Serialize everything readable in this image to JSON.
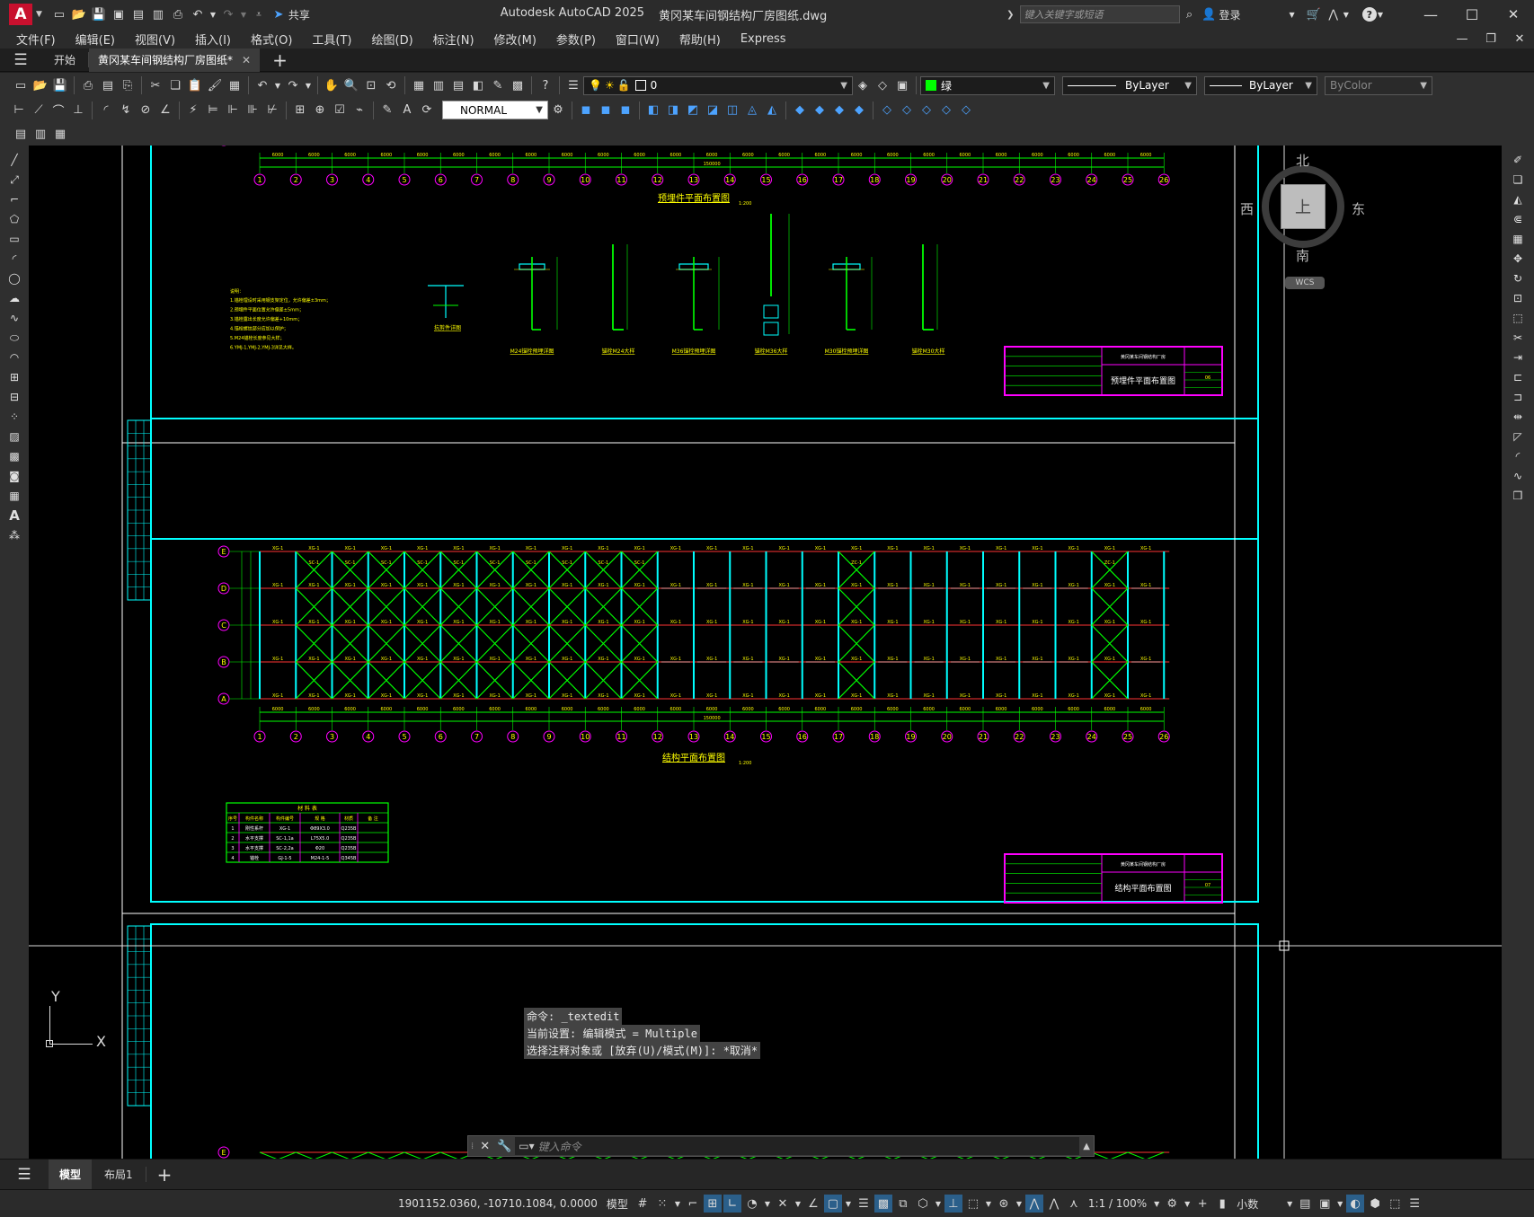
{
  "title_bar": {
    "app_letter": "A",
    "share_label": "共享",
    "window_title": "Autodesk AutoCAD 2025",
    "file_name": "黄冈某车间钢结构厂房图纸.dwg",
    "search_placeholder": "键入关键字或短语",
    "login_label": "登录"
  },
  "menu": [
    "文件(F)",
    "编辑(E)",
    "视图(V)",
    "插入(I)",
    "格式(O)",
    "工具(T)",
    "绘图(D)",
    "标注(N)",
    "修改(M)",
    "参数(P)",
    "窗口(W)",
    "帮助(H)",
    "Express"
  ],
  "doc_tabs": {
    "start": "开始",
    "active": "黄冈某车间钢结构厂房图纸*"
  },
  "toolbar": {
    "layer_value": "0",
    "color_value": "绿",
    "linetype_value": "ByLayer",
    "lineweight_value": "ByLayer",
    "plotstyle_value": "ByColor",
    "dimstyle_value": "NORMAL",
    "accent_green": "#00ff00"
  },
  "viewcube": {
    "north": "北",
    "south": "南",
    "east": "东",
    "west": "西",
    "face": "上",
    "wcs": "WCS"
  },
  "ucs": {
    "y": "Y",
    "x": "X"
  },
  "drawing": {
    "sheet1_title": "预埋件平面布置图",
    "sheet2_title": "结构平面布置图",
    "scale": "1:200",
    "overall_dim": "150000",
    "bay_dim": "6000",
    "axis_numbers": [
      "1",
      "2",
      "3",
      "4",
      "5",
      "6",
      "7",
      "8",
      "9",
      "10",
      "11",
      "12",
      "13",
      "14",
      "15",
      "16",
      "17",
      "18",
      "19",
      "20",
      "21",
      "22",
      "23",
      "24",
      "25",
      "26"
    ],
    "axis_letters": [
      "E",
      "D",
      "C",
      "B",
      "A"
    ],
    "notes_heading": "说明：",
    "notes": [
      "1.锚栓埋设时采用钢支架定位，允许偏差±3mm；",
      "2.预埋件平面位置允许偏差±5mm；",
      "3.锚栓露出长度允许偏差+10mm；",
      "4.锚栓螺纹部分应加以保护；",
      "5.M24锚栓长度参见大样；",
      "6.YMJ-1,YMJ-2,YMJ-3详见大样。"
    ],
    "detail_labels": [
      "抗剪件详图",
      "M24锚栓预埋详图",
      "锚栓M24大样",
      "M36锚栓预埋详图",
      "锚栓M36大样",
      "M30锚栓预埋详图",
      "锚栓M30大样"
    ],
    "title_block": {
      "project": "黄冈某车间钢结构厂房",
      "sheet1_name": "预埋件平面布置图",
      "sheet2_name": "结构平面布置图",
      "sheet1_no": "06",
      "sheet2_no": "07"
    },
    "member_labels": {
      "tie": "XG-1",
      "brace": "SC-1",
      "column_brace": "ZC-1"
    },
    "material_table": {
      "title": "材 料 表",
      "headers": [
        "序号",
        "构件名称",
        "构件编号",
        "规 格",
        "材质",
        "备 注"
      ],
      "rows": [
        [
          "1",
          "刚性系杆",
          "XG-1",
          "Φ89X3.0",
          "Q235B",
          ""
        ],
        [
          "2",
          "水平支撑",
          "SC-1,1a",
          "L75X5.0",
          "Q235B",
          ""
        ],
        [
          "3",
          "水平支撑",
          "SC-2,2a",
          "Φ20",
          "Q235B",
          ""
        ],
        [
          "4",
          "锚栓",
          "GJ-1-5",
          "M24-1-5",
          "Q345B",
          ""
        ]
      ]
    }
  },
  "command": {
    "history": [
      "命令: _textedit",
      "当前设置: 编辑模式 = Multiple",
      "选择注释对象或 [放弃(U)/模式(M)]: *取消*"
    ],
    "placeholder": "键入命令"
  },
  "layout_tabs": {
    "model": "模型",
    "layout1": "布局1"
  },
  "status": {
    "coords": "1901152.0360, -10710.1084, 0.0000",
    "model": "模型",
    "scale": "1:1 / 100%",
    "units": "小数"
  }
}
